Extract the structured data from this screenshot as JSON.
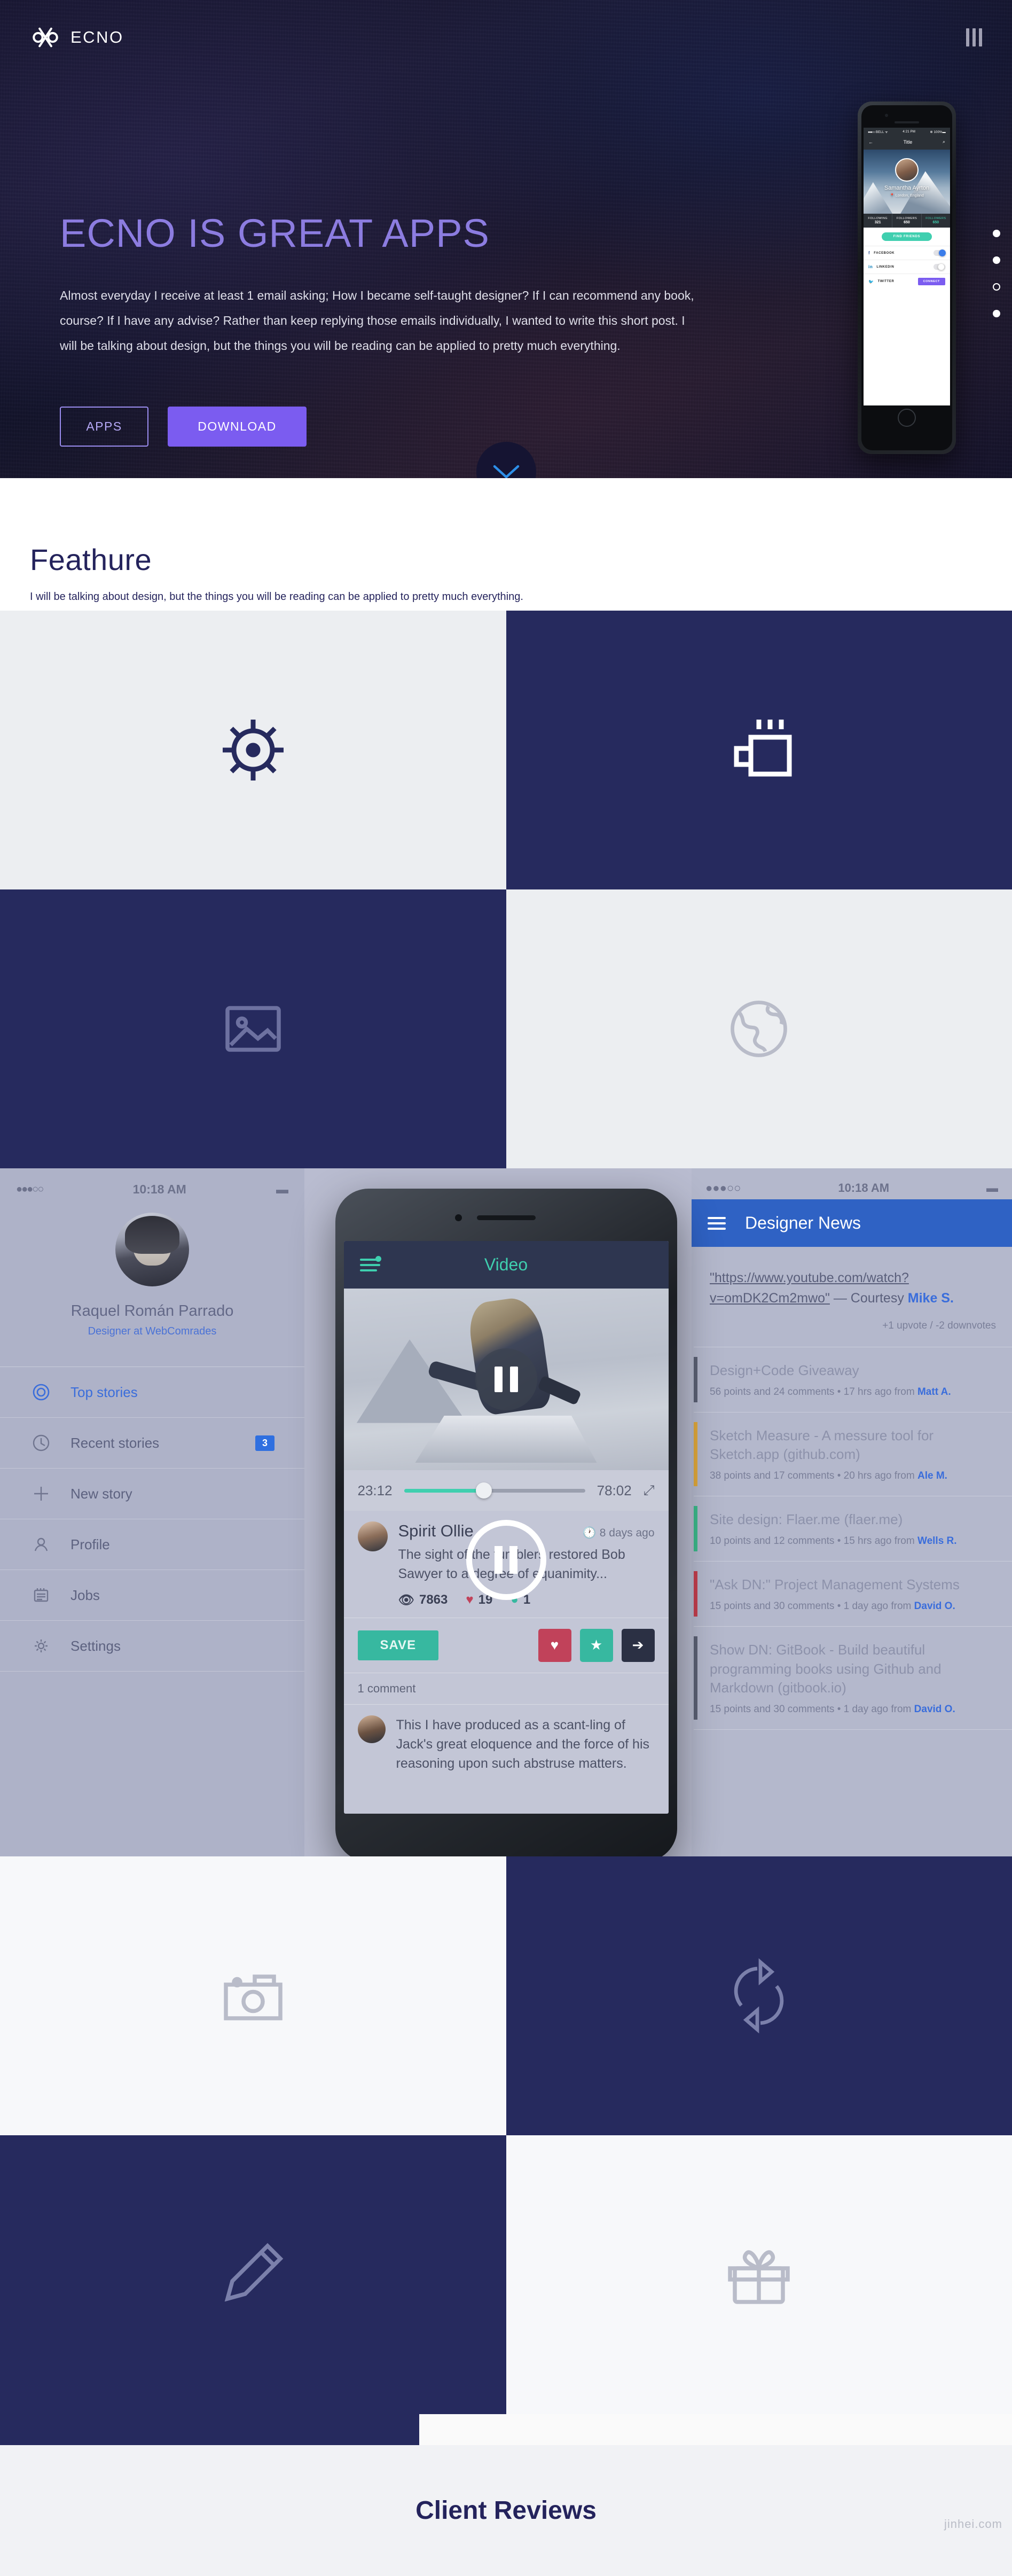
{
  "header": {
    "brand_name": "ECNO",
    "logo_icon": "interlocking-knot-logo",
    "menu_icon": "three-vertical-bars-menu-icon"
  },
  "hero": {
    "title": "ECNO IS GREAT APPS",
    "description": "Almost everyday I receive at least 1 email asking; How I became self-taught designer? If I can recommend any book, course? If I have any advise? Rather than keep replying those emails individually, I wanted to write this short post. I will be talking about design, but the things you will be reading can be applied to pretty much everything.",
    "buttons": [
      {
        "label": "APPS",
        "style": "ghost"
      },
      {
        "label": "DOWNLOAD",
        "style": "solid"
      }
    ],
    "accent_color": "#7b5cf0",
    "title_color": "#8c7ce0",
    "scroll_icon": "chevron-down-icon",
    "scroll_icon_color": "#2d8fe8",
    "pagination_dots": 4,
    "pagination_active_index": 2
  },
  "hero_phone": {
    "status": {
      "carrier": "BELL",
      "signal_dots": "●●●○○",
      "wifi_icon": "wifi-icon",
      "time": "4:21 PM",
      "bluetooth_icon": "bluetooth-icon",
      "battery": "100%"
    },
    "navbar": {
      "back_icon": "arrow-left-icon",
      "title": "Title",
      "search_icon": "search-icon"
    },
    "profile": {
      "name": "Samantha Ayrton",
      "location": "London, England",
      "location_icon": "map-pin-icon"
    },
    "stats": [
      {
        "label": "FOLLOWING",
        "value": "321"
      },
      {
        "label": "FOLLOWERS",
        "value": "650"
      },
      {
        "label": "FOLLOWERS",
        "value": "650",
        "highlight": true
      }
    ],
    "cta": "FIND FRIENDS",
    "cta_color": "#3fcfaf",
    "social": [
      {
        "icon": "facebook-icon",
        "glyph": "f",
        "label": "FACEBOOK",
        "control": "toggle-on"
      },
      {
        "icon": "linkedin-icon",
        "glyph": "in",
        "label": "LINKEDIN",
        "control": "toggle-off"
      },
      {
        "icon": "twitter-icon",
        "glyph": "🐦",
        "label": "TWITTER",
        "control": "button",
        "button_label": "CONNECT"
      }
    ]
  },
  "features": {
    "title": "Feathure",
    "subtitle": "I will be talking about design, but the things you will be reading can be applied to pretty much everything."
  },
  "feature_tiles_top": [
    {
      "icon": "sun-settings-icon",
      "theme": "light"
    },
    {
      "icon": "coffee-mug-icon",
      "theme": "dark"
    },
    {
      "icon": "image-photo-icon",
      "theme": "dark"
    },
    {
      "icon": "globe-world-icon",
      "theme": "light"
    }
  ],
  "feature_tiles_bottom": [
    {
      "icon": "camera-icon",
      "theme": "light2"
    },
    {
      "icon": "sync-refresh-icon",
      "theme": "dark"
    },
    {
      "icon": "pencil-edit-icon",
      "theme": "dark"
    },
    {
      "icon": "gift-box-icon",
      "theme": "light2"
    }
  ],
  "showcase": {
    "left_app": {
      "status": {
        "dots": "●●●○○",
        "time": "10:18 AM",
        "battery_icon": "battery-icon"
      },
      "profile": {
        "name": "Raquel Román Parrado",
        "role": "Designer at WebComrades",
        "avatar": "user-avatar"
      },
      "menu": [
        {
          "icon": "target-circle-icon",
          "label": "Top stories",
          "active": true,
          "badge": ""
        },
        {
          "icon": "clock-icon",
          "label": "Recent stories",
          "active": false,
          "badge": "3"
        },
        {
          "icon": "plus-icon",
          "label": "New story",
          "active": false,
          "badge": ""
        },
        {
          "icon": "person-icon",
          "label": "Profile",
          "active": false,
          "badge": ""
        },
        {
          "icon": "notebook-icon",
          "label": "Jobs",
          "active": false,
          "badge": ""
        },
        {
          "icon": "gear-icon",
          "label": "Settings",
          "active": false,
          "badge": ""
        }
      ]
    },
    "center_phone": {
      "header": {
        "filter_icon": "filter-slider-icon",
        "title": "Video"
      },
      "player": {
        "pause_icon": "pause-icon",
        "current_time": "23:12",
        "total_time": "78:02",
        "progress_percent": 44,
        "expand_icon": "expand-arrows-icon",
        "progress_color": "#3fcfaf"
      },
      "post": {
        "author": "Spirit Ollie",
        "time_icon": "clock-icon",
        "time": "8 days ago",
        "text": "The sight of the tumblers restored Bob Sawyer to a degree of equanimity...",
        "views_icon": "eye-icon",
        "views": "7863",
        "likes_icon": "heart-icon",
        "likes": "19",
        "comments_icon": "comment-bubble-icon",
        "comments": "1"
      },
      "actions": {
        "save_label": "SAVE",
        "save_color": "#37b8a0",
        "buttons": [
          {
            "icon": "heart-icon",
            "glyph": "♥",
            "color": "#c1425a"
          },
          {
            "icon": "star-icon",
            "glyph": "★",
            "color": "#37b8a0"
          },
          {
            "icon": "share-arrow-icon",
            "glyph": "➔",
            "color": "#2b3044"
          }
        ]
      },
      "comments_header": "1 comment",
      "comment": {
        "text": "This I have produced as a scant-ling of Jack's great eloquence and the force of his reasoning upon such abstruse matters."
      }
    },
    "right_app": {
      "status": {
        "dots": "●●●○○",
        "time": "10:18 AM",
        "battery_icon": "battery-icon"
      },
      "navbar": {
        "hamburger_icon": "hamburger-menu-icon",
        "title": "Designer News"
      },
      "quote": {
        "link": "\"https://www.youtube.com/watch?v=omDK2Cm2mwo\"",
        "courtesy_prefix": " — Courtesy ",
        "courtesy_author": "Mike S.",
        "votes": "+1 upvote / -2 downvotes"
      },
      "stories": [
        {
          "title": "Design+Code Giveaway",
          "source": "",
          "meta": "56 points and 24 comments  •  17 hrs ago from ",
          "author": "Matt A.",
          "bar_color": "#5b6074",
          "muted": false
        },
        {
          "title": "Sketch Measure - A messure tool for Sketch.app",
          "source": "(github.com)",
          "meta": "38 points and 17 comments  •  20 hrs ago from ",
          "author": "Ale M.",
          "bar_color": "#e0a83c",
          "muted": false
        },
        {
          "title": "Site design: Flaer.me",
          "source": "(flaer.me)",
          "meta": "10 points and 12 comments  •  15 hrs ago from ",
          "author": "Wells R.",
          "bar_color": "#3bb98a",
          "muted": false
        },
        {
          "title": "\"Ask DN:\" Project Management Systems",
          "source": "",
          "meta": "15 points and 30 comments  •  1 day ago from ",
          "author": "David O.",
          "bar_color": "#c33f4e",
          "muted": true
        },
        {
          "title": "Show DN: GitBook - Build beautiful programming books using Github and Markdown",
          "source": "(gitbook.io)",
          "meta": "15 points and 30 comments  •  1 day ago from ",
          "author": "David O.",
          "bar_color": "#5b6074",
          "muted": false
        }
      ]
    }
  },
  "reviews": {
    "title": "Client Reviews"
  },
  "watermark": "jinhei.com"
}
